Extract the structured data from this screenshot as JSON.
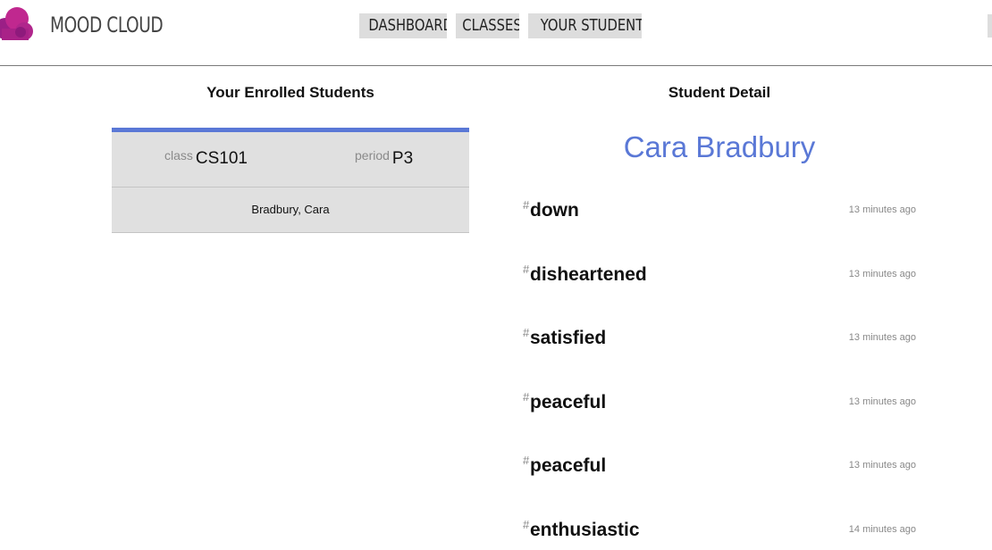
{
  "header": {
    "brand": "MOOD CLOUD",
    "nav": [
      "DASHBOARD",
      "CLASSES",
      "YOUR STUDENTS"
    ]
  },
  "enrolled": {
    "title": "Your Enrolled Students",
    "class_label": "class",
    "class_value": "CS101",
    "period_label": "period",
    "period_value": "P3",
    "students": [
      "Bradbury, Cara"
    ]
  },
  "detail": {
    "title": "Student Detail",
    "student_name": "Cara Bradbury",
    "hash_symbol": "#",
    "moods": [
      {
        "tag": "down",
        "time": "13 minutes ago"
      },
      {
        "tag": "disheartened",
        "time": "13 minutes ago"
      },
      {
        "tag": "satisfied",
        "time": "13 minutes ago"
      },
      {
        "tag": "peaceful",
        "time": "13 minutes ago"
      },
      {
        "tag": "peaceful",
        "time": "13 minutes ago"
      },
      {
        "tag": "enthusiastic",
        "time": "14 minutes ago"
      }
    ]
  },
  "colors": {
    "accent": "#5a78d6",
    "logo": "#b0268c",
    "nav_bg": "#dddddd",
    "card_bg": "#e0e0e0"
  },
  "icons": {
    "logo": "cloud-logo-icon"
  }
}
